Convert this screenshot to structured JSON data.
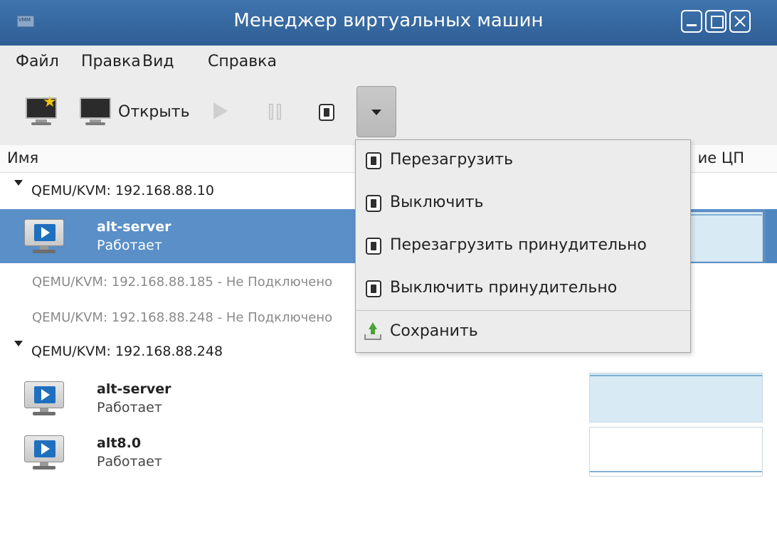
{
  "window": {
    "title": "Менеджер виртуальных машин"
  },
  "menubar": {
    "file": "Файл",
    "edit": "Правка",
    "view": "Вид",
    "help": "Справка"
  },
  "toolbar": {
    "open_label": "Открыть"
  },
  "columns": {
    "name": "Имя",
    "cpu_usage": "ие ЦП"
  },
  "connections": [
    {
      "label": "QEMU/KVM: 192.168.88.10",
      "vms": [
        {
          "name": "alt-server",
          "status": "Работает"
        }
      ]
    },
    {
      "label": "QEMU/KVM: 192.168.88.185 - Не Подключено"
    },
    {
      "label": "QEMU/KVM: 192.168.88.248 - Не Подключено"
    },
    {
      "label": "QEMU/KVM: 192.168.88.248",
      "vms": [
        {
          "name": "alt-server",
          "status": "Работает"
        },
        {
          "name": "alt8.0",
          "status": "Работает"
        }
      ]
    }
  ],
  "shutdown_menu": {
    "items": [
      "Перезагрузить",
      "Выключить",
      "Перезагрузить принудительно",
      "Выключить принудительно",
      "Сохранить"
    ]
  },
  "colors": {
    "titlebar": "#3a6ba3",
    "selection": "#5a8fc7",
    "menu_bg": "#ececec"
  }
}
